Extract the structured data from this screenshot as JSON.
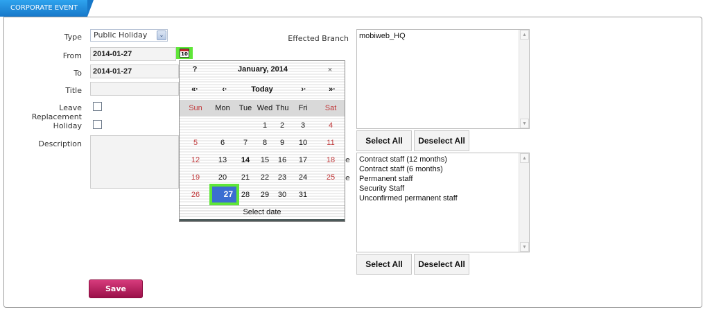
{
  "tab": {
    "label": "CORPORATE EVENT"
  },
  "form": {
    "type_label": "Type",
    "type_value": "Public Holiday",
    "from_label": "From",
    "from_value": "2014-01-27",
    "to_label": "To",
    "to_value": "2014-01-27",
    "title_label": "Title",
    "title_value": "",
    "leave_replacement_label": "Leave Replacement",
    "holiday_label": "Holiday",
    "description_label": "Description",
    "save_label": "Save",
    "hidden_label_fragment_1": "e",
    "hidden_label_fragment_2": "e"
  },
  "calendar_icon": {
    "text": "10"
  },
  "calendar": {
    "help": "?",
    "month_title": "January, 2014",
    "close": "×",
    "prev_year": "«·",
    "prev_month": "‹·",
    "today": "Today",
    "next_month": "›·",
    "next_year": "»·",
    "weekdays": [
      "Sun",
      "Mon",
      "Tue",
      "Wed",
      "Thu",
      "Fri",
      "Sat"
    ],
    "weeks": [
      [
        "",
        "",
        "",
        "1",
        "2",
        "3",
        "4"
      ],
      [
        "5",
        "6",
        "7",
        "8",
        "9",
        "10",
        "11"
      ],
      [
        "12",
        "13",
        "14",
        "15",
        "16",
        "17",
        "18"
      ],
      [
        "19",
        "20",
        "21",
        "22",
        "23",
        "24",
        "25"
      ],
      [
        "26",
        "27",
        "28",
        "29",
        "30",
        "31",
        ""
      ]
    ],
    "selected_day": "27",
    "today_day": "14",
    "footer": "Select date"
  },
  "branch": {
    "label": "Effected Branch",
    "items": [
      "mobiweb_HQ"
    ],
    "select_all": "Select All",
    "deselect_all": "Deselect All"
  },
  "staff": {
    "items": [
      "Contract staff (12 months)",
      "Contract staff (6 months)",
      "Permanent staff",
      "Security Staff",
      "Unconfirmed permanent staff"
    ],
    "select_all": "Select All",
    "deselect_all": "Deselect All"
  },
  "scroll": {
    "up": "▲",
    "down": "▼"
  },
  "dropdown_arrow": "⌄"
}
